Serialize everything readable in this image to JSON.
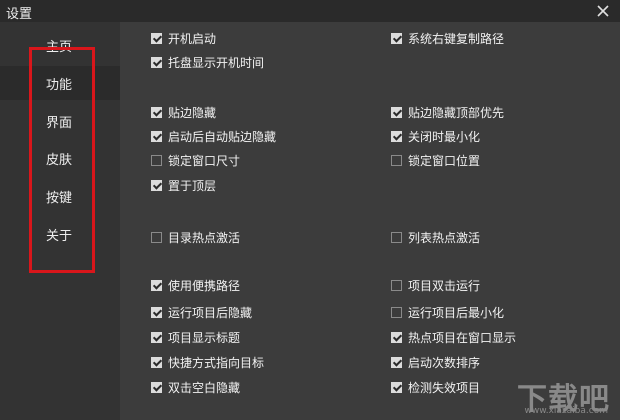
{
  "window": {
    "title": "设置"
  },
  "sidebar": {
    "items": [
      {
        "label": "主页",
        "active": false
      },
      {
        "label": "功能",
        "active": true
      },
      {
        "label": "界面",
        "active": false
      },
      {
        "label": "皮肤",
        "active": false
      },
      {
        "label": "按键",
        "active": false
      },
      {
        "label": "关于",
        "active": false
      }
    ]
  },
  "options": [
    {
      "label": "开机启动",
      "checked": true
    },
    {
      "label": "系统右键复制路径",
      "checked": true
    },
    {
      "label": "托盘显示开机时间",
      "checked": true
    },
    {
      "label": "贴边隐藏",
      "checked": true
    },
    {
      "label": "贴边隐藏顶部优先",
      "checked": true
    },
    {
      "label": "启动后自动贴边隐藏",
      "checked": true
    },
    {
      "label": "关闭时最小化",
      "checked": true
    },
    {
      "label": "锁定窗口尺寸",
      "checked": false
    },
    {
      "label": "锁定窗口位置",
      "checked": false
    },
    {
      "label": "置于顶层",
      "checked": true
    },
    {
      "label": "目录热点激活",
      "checked": false
    },
    {
      "label": "列表热点激活",
      "checked": false
    },
    {
      "label": "使用便携路径",
      "checked": true
    },
    {
      "label": "项目双击运行",
      "checked": false
    },
    {
      "label": "运行项目后隐藏",
      "checked": true
    },
    {
      "label": "运行项目后最小化",
      "checked": false
    },
    {
      "label": "项目显示标题",
      "checked": true
    },
    {
      "label": "热点项目在窗口显示",
      "checked": true
    },
    {
      "label": "快捷方式指向目标",
      "checked": true
    },
    {
      "label": "启动次数排序",
      "checked": true
    },
    {
      "label": "双击空白隐藏",
      "checked": true
    },
    {
      "label": "检测失效项目",
      "checked": true
    }
  ],
  "watermark": {
    "text": "下载吧",
    "sub": "www.xiazaiba.com"
  },
  "colors": {
    "highlight": "#d9161b",
    "background": "#3c3c3c",
    "sidebar": "#333333"
  }
}
